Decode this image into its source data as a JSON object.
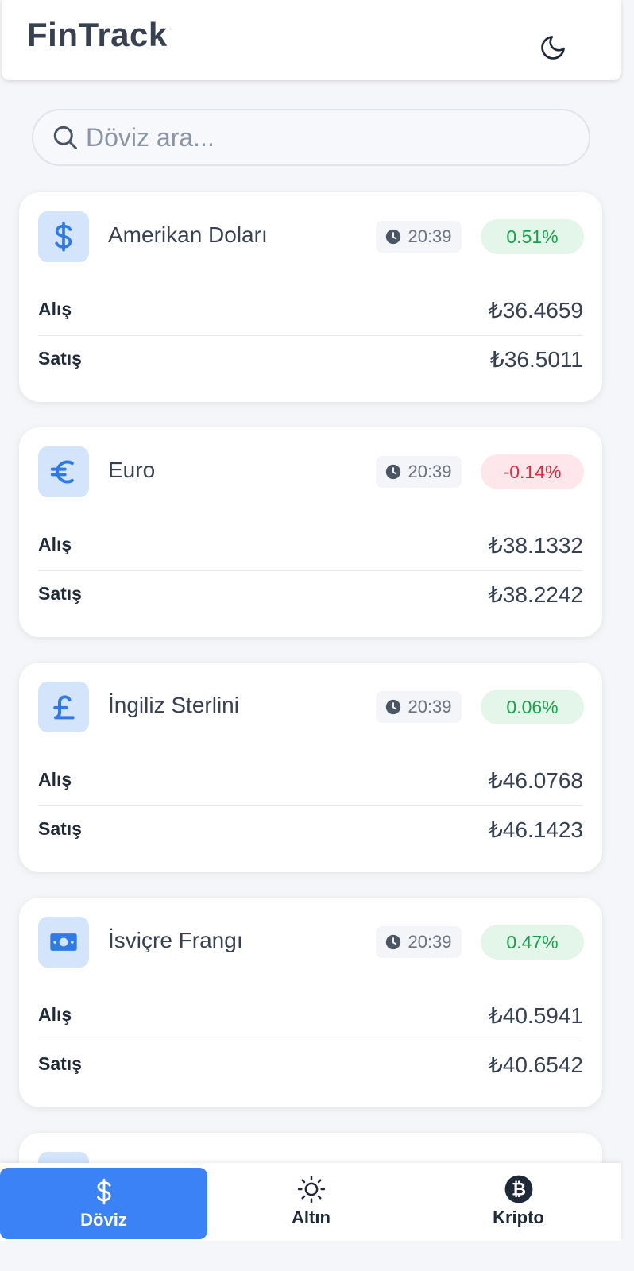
{
  "app": {
    "title": "FinTrack"
  },
  "search": {
    "placeholder": "Döviz ara..."
  },
  "labels": {
    "buy": "Alış",
    "sell": "Satış"
  },
  "colors": {
    "accent": "#3b82f6",
    "positive": "#16a34a",
    "negative": "#dc2d3f",
    "icon_bg": "#d3e4fb"
  },
  "currencies": [
    {
      "name": "Amerikan Doları",
      "icon": "dollar-icon",
      "time": "20:39",
      "change": "0.51%",
      "direction": "up",
      "buy": "₺36.4659",
      "sell": "₺36.5011"
    },
    {
      "name": "Euro",
      "icon": "euro-icon",
      "time": "20:39",
      "change": "-0.14%",
      "direction": "down",
      "buy": "₺38.1332",
      "sell": "₺38.2242"
    },
    {
      "name": "İngiliz Sterlini",
      "icon": "pound-icon",
      "time": "20:39",
      "change": "0.06%",
      "direction": "up",
      "buy": "₺46.0768",
      "sell": "₺46.1423"
    },
    {
      "name": "İsviçre Frangı",
      "icon": "banknote-icon",
      "time": "20:39",
      "change": "0.47%",
      "direction": "up",
      "buy": "₺40.5941",
      "sell": "₺40.6542"
    }
  ],
  "nav": [
    {
      "label": "Döviz",
      "icon": "dollar-icon",
      "active": true
    },
    {
      "label": "Altın",
      "icon": "sun-icon",
      "active": false
    },
    {
      "label": "Kripto",
      "icon": "bitcoin-icon",
      "active": false
    }
  ]
}
